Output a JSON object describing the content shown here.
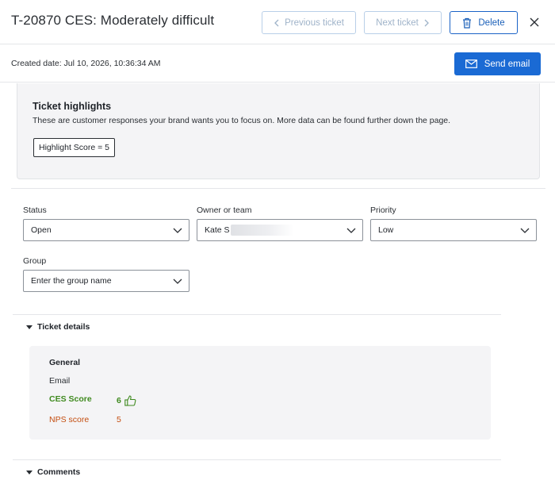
{
  "header": {
    "title": "T-20870 CES: Moderately difficult",
    "prev_label": "Previous ticket",
    "next_label": "Next ticket",
    "delete_label": "Delete"
  },
  "subheader": {
    "created": "Created date: Jul 10, 2026, 10:36:34 AM",
    "send_label": "Send email"
  },
  "highlights": {
    "title": "Ticket highlights",
    "description": "These are customer responses your brand wants you to focus on. More data can be found further down the page.",
    "chip": "Highlight Score = 5"
  },
  "fields": {
    "status": {
      "label": "Status",
      "value": "Open"
    },
    "owner": {
      "label": "Owner or team",
      "value": "Kate S"
    },
    "priority": {
      "label": "Priority",
      "value": "Low"
    },
    "group": {
      "label": "Group",
      "placeholder": "Enter the group name"
    }
  },
  "ticket_details": {
    "heading": "Ticket details",
    "general_title": "General",
    "email_label": "Email",
    "ces_label": "CES Score",
    "ces_value": "6",
    "nps_label": "NPS score",
    "nps_value": "5"
  },
  "comments": {
    "heading": "Comments"
  },
  "colors": {
    "primary": "#1a6ad4",
    "positive": "#3f8a1f",
    "warning": "#c44d0f"
  },
  "icons": [
    "chevron-left-icon",
    "chevron-right-icon",
    "trash-icon",
    "close-icon",
    "mail-icon",
    "chevron-down-icon",
    "caret-down-icon",
    "thumbs-up-icon"
  ]
}
